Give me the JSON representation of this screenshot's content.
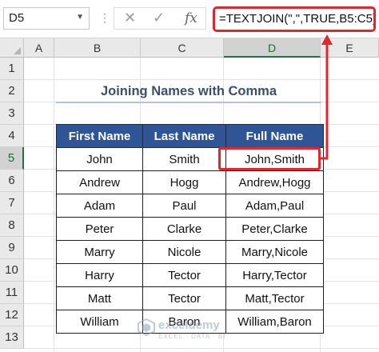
{
  "formula_bar": {
    "name_box": "D5",
    "cancel_glyph": "✕",
    "enter_glyph": "✓",
    "fx_label": "fx",
    "formula": "=TEXTJOIN(\",\",TRUE,B5:C5)"
  },
  "columns": [
    "A",
    "B",
    "C",
    "D",
    "E"
  ],
  "rows": [
    "1",
    "2",
    "3",
    "4",
    "5",
    "6",
    "7",
    "8",
    "9",
    "10",
    "11",
    "12",
    "13"
  ],
  "selected": {
    "column": "D",
    "row": "5"
  },
  "title": "Joining Names with Comma",
  "table": {
    "headers": [
      "First Name",
      "Last Name",
      "Full Name"
    ],
    "rows": [
      [
        "John",
        "Smith",
        "John,Smith"
      ],
      [
        "Andrew",
        "Hogg",
        "Andrew,Hogg"
      ],
      [
        "Adam",
        "Paul",
        "Adam,Paul"
      ],
      [
        "Peter",
        "Clarke",
        "Peter,Clarke"
      ],
      [
        "Marry",
        "Nicole",
        "Marry,Nicole"
      ],
      [
        "Harry",
        "Tector",
        "Harry,Tector"
      ],
      [
        "Matt",
        "Tector",
        "Matt,Tector"
      ],
      [
        "William",
        "Baron",
        "William,Baron"
      ]
    ]
  },
  "watermark": {
    "name": "exceldemy",
    "tagline": "EXCEL · DATA · BI"
  },
  "colors": {
    "header_fill": "#2f5596",
    "highlight": "#e1262d",
    "title_text": "#3b4f6b"
  }
}
